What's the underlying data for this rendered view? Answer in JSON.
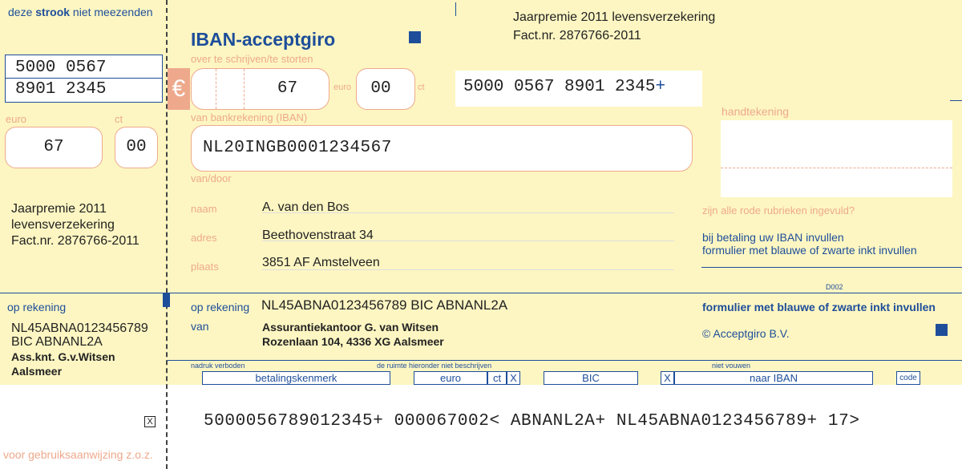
{
  "stub": {
    "header_pre": "deze ",
    "header_bold": "strook",
    "header_post": " niet meezenden",
    "ref_line1": "5000  0567",
    "ref_line2": "8901  2345",
    "euro_label": "euro",
    "ct_label": "ct",
    "euro_value": "67",
    "ct_value": "00",
    "desc_line1": "Jaarpremie 2011",
    "desc_line2": "levensverzekering",
    "desc_line3": "Fact.nr. 2876766-2011",
    "op_rekening_label": "op rekening",
    "iban_line": "NL45ABNA0123456789",
    "bic_line": "BIC ABNANL2A",
    "name_line": "Ass.knt. G.v.Witsen",
    "city_line": "Aalsmeer",
    "footer": "voor gebruiksaanwijzing z.o.z."
  },
  "main": {
    "title": "IBAN-acceptgiro",
    "subtitle": "over te schrijven/te storten",
    "euro_symbol": "€",
    "amount": "67",
    "euro_label": "euro",
    "cents": "00",
    "ct_label": "ct",
    "payment_reference": "5000  0567  8901  2345",
    "payment_reference_suffix": "+",
    "header_desc_line1": "Jaarpremie 2011 levensverzekering",
    "header_desc_line2": "Fact.nr. 2876766-2011",
    "van_bankrekening_label": "van bankrekening (IBAN)",
    "payer_iban": "NL20INGB0001234567",
    "van_door_label": "van/door",
    "naam_label": "naam",
    "naam_value": "A. van den Bos",
    "adres_label": "adres",
    "adres_value": "Beethovenstraat 34",
    "plaats_label": "plaats",
    "plaats_value": "3851 AF  Amstelveen",
    "handtekening_label": "handtekening",
    "rode_rubrieken": "zijn alle rode rubrieken ingevuld?",
    "iban_instruction_line1": "bij betaling uw IBAN invullen",
    "iban_instruction_line2": "formulier met blauwe of zwarte inkt invullen",
    "form_code": "D002",
    "op_rekening_label": "op rekening",
    "op_rekening_value": "NL45ABNA0123456789  BIC ABNANL2A",
    "van_label": "van",
    "van_line1": "Assurantiekantoor G. van Witsen",
    "van_line2": "Rozenlaan 104, 4336 XG  Aalsmeer",
    "ink_instruction": "formulier met blauwe of zwarte inkt invullen",
    "copyright": "© Acceptgiro B.V."
  },
  "bottom_strip": {
    "nadruk": "nadruk verboden",
    "ruimte": "de ruimte hieronder niet beschrijven",
    "niet_vouwen": "niet vouwen",
    "betalingskenmerk": "betalingskenmerk",
    "euro": "euro",
    "ct": "ct",
    "x1": "X",
    "bic": "BIC",
    "x2": "X",
    "naar_iban": "naar IBAN",
    "code": "code"
  },
  "ocr": {
    "check_mark": "X",
    "line": "5000056789012345+  000067002<  ABNANL2A+  NL45ABNA0123456789+  17>"
  },
  "colors": {
    "background_yellow": "#fdf6c2",
    "text_blue": "#1e4e9a",
    "accent_salmon": "#eea98c"
  }
}
